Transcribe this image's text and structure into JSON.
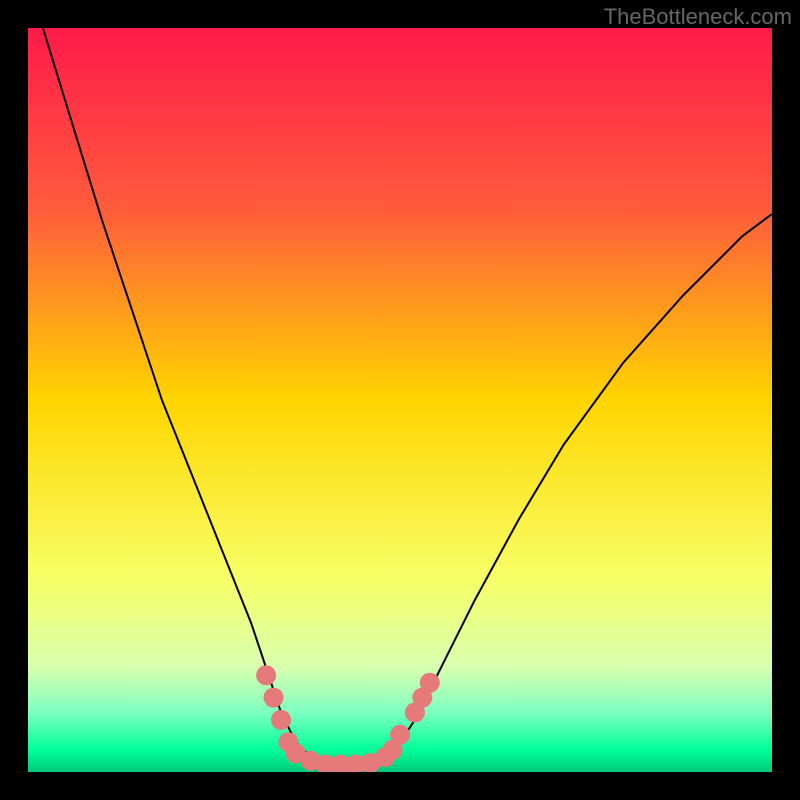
{
  "watermark": "TheBottleneck.com",
  "chart_data": {
    "type": "line",
    "title": "",
    "xlabel": "",
    "ylabel": "",
    "xlim": [
      0,
      100
    ],
    "ylim": [
      0,
      100
    ],
    "grid": false,
    "gradient_stops": [
      {
        "offset": 0,
        "color": "#ff1a4a"
      },
      {
        "offset": 24,
        "color": "#ff5a3c"
      },
      {
        "offset": 50,
        "color": "#ffd500"
      },
      {
        "offset": 74,
        "color": "#f7ff66"
      },
      {
        "offset": 86,
        "color": "#d8ffb0"
      },
      {
        "offset": 92,
        "color": "#7dffc0"
      },
      {
        "offset": 97,
        "color": "#00ff99"
      },
      {
        "offset": 100,
        "color": "#00c97a"
      }
    ],
    "series": [
      {
        "name": "bottleneck-curve",
        "color": "#000000",
        "points": [
          {
            "x": 2,
            "y": 100
          },
          {
            "x": 6,
            "y": 87
          },
          {
            "x": 10,
            "y": 74
          },
          {
            "x": 14,
            "y": 62
          },
          {
            "x": 18,
            "y": 50
          },
          {
            "x": 22,
            "y": 40
          },
          {
            "x": 26,
            "y": 30
          },
          {
            "x": 30,
            "y": 20
          },
          {
            "x": 32,
            "y": 14
          },
          {
            "x": 34,
            "y": 8
          },
          {
            "x": 36,
            "y": 4
          },
          {
            "x": 38,
            "y": 2
          },
          {
            "x": 42,
            "y": 1
          },
          {
            "x": 46,
            "y": 1
          },
          {
            "x": 48,
            "y": 2
          },
          {
            "x": 50,
            "y": 4
          },
          {
            "x": 52,
            "y": 7
          },
          {
            "x": 56,
            "y": 15
          },
          {
            "x": 60,
            "y": 23
          },
          {
            "x": 66,
            "y": 34
          },
          {
            "x": 72,
            "y": 44
          },
          {
            "x": 80,
            "y": 55
          },
          {
            "x": 88,
            "y": 64
          },
          {
            "x": 96,
            "y": 72
          },
          {
            "x": 100,
            "y": 75
          }
        ]
      }
    ],
    "markers": {
      "name": "highlight-dots",
      "color": "#e67a7a",
      "radius": 10,
      "points": [
        {
          "x": 32,
          "y": 13
        },
        {
          "x": 33,
          "y": 10
        },
        {
          "x": 34,
          "y": 7
        },
        {
          "x": 35,
          "y": 4
        },
        {
          "x": 36,
          "y": 2.5
        },
        {
          "x": 38,
          "y": 1.5
        },
        {
          "x": 40,
          "y": 1
        },
        {
          "x": 42,
          "y": 1
        },
        {
          "x": 44,
          "y": 1
        },
        {
          "x": 46,
          "y": 1.2
        },
        {
          "x": 48,
          "y": 2
        },
        {
          "x": 49,
          "y": 3
        },
        {
          "x": 50,
          "y": 5
        },
        {
          "x": 52,
          "y": 8
        },
        {
          "x": 53,
          "y": 10
        },
        {
          "x": 54,
          "y": 12
        }
      ]
    }
  }
}
